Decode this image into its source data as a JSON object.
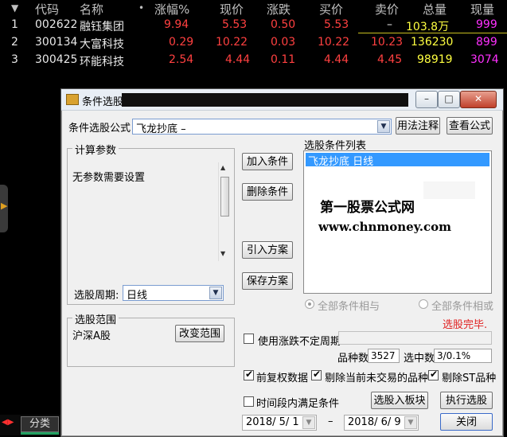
{
  "stock_table": {
    "headers": [
      "代码",
      "名称",
      "涨幅%",
      "现价",
      "涨跌",
      "买价",
      "卖价",
      "总量",
      "现量"
    ],
    "sort_marker": "▼",
    "name_dot": "•",
    "rows": [
      {
        "idx": "1",
        "code": "002622",
        "name": "融钰集团",
        "pct": "9.94",
        "price": "5.53",
        "chg": "0.50",
        "bid": "5.53",
        "ask": "–",
        "vol": "103.8万",
        "cur": "999"
      },
      {
        "idx": "2",
        "code": "300134",
        "name": "大富科技",
        "pct": "0.29",
        "price": "10.22",
        "chg": "0.03",
        "bid": "10.22",
        "ask": "10.23",
        "vol": "136230",
        "cur": "899"
      },
      {
        "idx": "3",
        "code": "300425",
        "name": "环能科技",
        "pct": "2.54",
        "price": "4.44",
        "chg": "0.11",
        "bid": "4.44",
        "ask": "4.45",
        "vol": "98919",
        "cur": "3074"
      }
    ]
  },
  "bottom_bar": {
    "tab": "分类"
  },
  "dialog": {
    "title": "条件选股",
    "window_buttons": {
      "minimize": "–",
      "maximize": "□",
      "close": "✕"
    },
    "formula_label": "条件选股公式",
    "formula_value": "飞龙抄底        –",
    "usage_button": "用法注释",
    "view_formula_button": "查看公式",
    "calc_params_title": "计算参数",
    "no_params_text": "无参数需要设置",
    "period_label": "选股周期:",
    "period_value": "日线",
    "add_condition": "加入条件",
    "delete_condition": "删除条件",
    "import_plan": "引入方案",
    "save_plan": "保存方案",
    "condition_list_title": "选股条件列表",
    "condition_items": [
      "飞龙抄底   日线"
    ],
    "watermark_title": "第一股票公式网",
    "watermark_url": "www.chnmoney.com",
    "radio_and": "全部条件相与",
    "radio_or": "全部条件相或",
    "status": "选股完毕.",
    "range_title": "选股范围",
    "range_value": "沪深A股",
    "change_range": "改变范围",
    "use_variable_period": "使用涨跌不定周期",
    "species_label": "品种数",
    "species_value": "3527",
    "selected_label": "选中数",
    "selected_value": "3/0.1%",
    "pre_adjust": "前复权数据",
    "exclude_untraded": "剔除当前未交易的品种",
    "exclude_st": "剔除ST品种",
    "time_range": "时间段内满足条件",
    "to_block": "选股入板块",
    "execute": "执行选股",
    "date_from": "2018/ 5/ 1",
    "date_sep": "–",
    "date_to": "2018/ 6/ 9",
    "close_button": "关闭"
  }
}
